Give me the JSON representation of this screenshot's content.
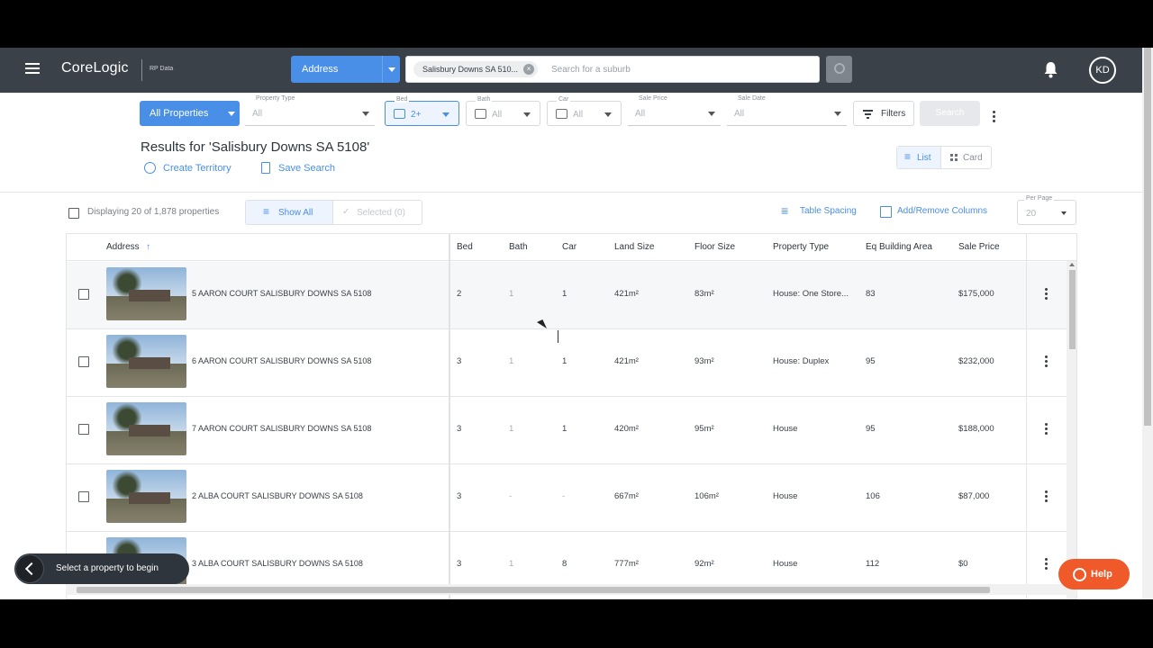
{
  "header": {
    "app_name": "CoreLogic",
    "app_sub": "RP Data",
    "search_type": "Address",
    "search_chip": "Salisbury Downs SA 510...",
    "search_placeholder": "Search for a suburb",
    "user_initials": "KD"
  },
  "filters": {
    "property_scope": "All Properties",
    "property_type": {
      "label": "Property Type",
      "value": "All"
    },
    "bed": {
      "label": "Bed",
      "value": "2+"
    },
    "bath": {
      "label": "Bath",
      "value": "All"
    },
    "car": {
      "label": "Car",
      "value": "All"
    },
    "sale_price": {
      "label": "Sale Price",
      "value": "All"
    },
    "sale_date": {
      "label": "Sale Date",
      "value": "All"
    },
    "filters_label": "Filters",
    "search_label": "Search"
  },
  "results": {
    "title": "Results for 'Salisbury Downs SA 5108'",
    "create_territory": "Create Territory",
    "save_search": "Save Search",
    "view_list": "List",
    "view_card": "Card"
  },
  "toolbar": {
    "displaying": "Displaying 20 of 1,878 properties",
    "show_all": "Show All",
    "selected": "Selected (0)",
    "table_spacing": "Table Spacing",
    "add_remove_columns": "Add/Remove Columns",
    "per_page_label": "Per Page",
    "per_page_value": "20"
  },
  "table": {
    "columns": [
      "Address",
      "Bed",
      "Bath",
      "Car",
      "Land Size",
      "Floor Size",
      "Property Type",
      "Eq Building Area",
      "Sale Price"
    ],
    "rows": [
      {
        "address": "5 AARON COURT SALISBURY DOWNS SA 5108",
        "bed": "2",
        "bath": "1",
        "car": "1",
        "land": "421m²",
        "floor": "83m²",
        "type": "House: One Store...",
        "eq": "83",
        "price": "$175,000"
      },
      {
        "address": "6 AARON COURT SALISBURY DOWNS SA 5108",
        "bed": "3",
        "bath": "1",
        "car": "1",
        "land": "421m²",
        "floor": "93m²",
        "type": "House: Duplex",
        "eq": "95",
        "price": "$232,000"
      },
      {
        "address": "7 AARON COURT SALISBURY DOWNS SA 5108",
        "bed": "3",
        "bath": "1",
        "car": "1",
        "land": "420m²",
        "floor": "95m²",
        "type": "House",
        "eq": "95",
        "price": "$188,000"
      },
      {
        "address": "2 ALBA COURT SALISBURY DOWNS SA 5108",
        "bed": "3",
        "bath": "-",
        "car": "-",
        "land": "667m²",
        "floor": "106m²",
        "type": "House",
        "eq": "106",
        "price": "$87,000"
      },
      {
        "address": "3 ALBA COURT SALISBURY DOWNS SA 5108",
        "bed": "3",
        "bath": "1",
        "car": "8",
        "land": "777m²",
        "floor": "92m²",
        "type": "House",
        "eq": "112",
        "price": "$0"
      }
    ]
  },
  "toast": {
    "text": "Select a property to begin"
  },
  "help": {
    "label": "Help"
  },
  "colors": {
    "topbar": "#3b4149",
    "accent": "#4a8fe7",
    "help": "#f05a2a"
  }
}
